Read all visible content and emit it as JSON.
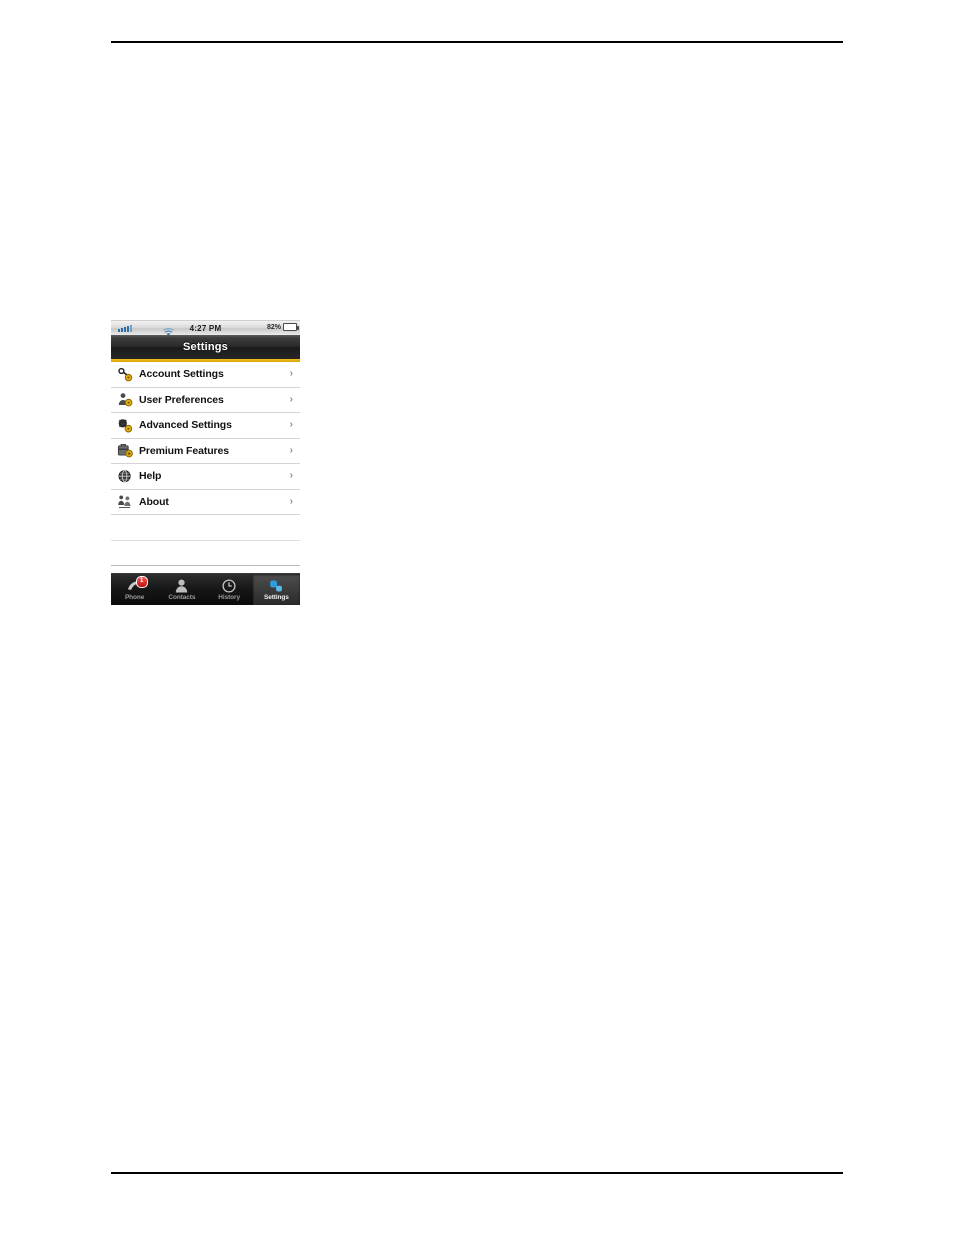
{
  "page": {
    "top_rule": "",
    "bottom_rule": ""
  },
  "phone": {
    "status_bar": {
      "signal_icon": "cellular-signal-icon",
      "wifi_icon": "wifi-icon",
      "time": "4:27 PM",
      "battery_percent": "82%",
      "battery_level": 82,
      "battery_icon": "battery-charging-icon"
    },
    "title_bar": {
      "title": "Settings",
      "accent_color": "#e8b412"
    },
    "menu": {
      "items": [
        {
          "label": "Account Settings",
          "icon": "account-key-icon",
          "chevron": "›"
        },
        {
          "label": "User Preferences",
          "icon": "user-gear-icon",
          "chevron": "›"
        },
        {
          "label": "Advanced Settings",
          "icon": "gears-icon",
          "chevron": "›"
        },
        {
          "label": "Premium Features",
          "icon": "briefcase-add-icon",
          "chevron": "›"
        },
        {
          "label": "Help",
          "icon": "globe-help-icon",
          "chevron": "›"
        },
        {
          "label": "About",
          "icon": "people-info-icon",
          "chevron": "›"
        }
      ]
    },
    "tab_bar": {
      "tabs": [
        {
          "label": "Phone",
          "icon": "handset-icon",
          "selected": false,
          "badge": "1"
        },
        {
          "label": "Contacts",
          "icon": "person-icon",
          "selected": false,
          "badge": ""
        },
        {
          "label": "History",
          "icon": "clock-icon",
          "selected": false,
          "badge": ""
        },
        {
          "label": "Settings",
          "icon": "gears-icon",
          "selected": true,
          "badge": ""
        }
      ]
    }
  }
}
